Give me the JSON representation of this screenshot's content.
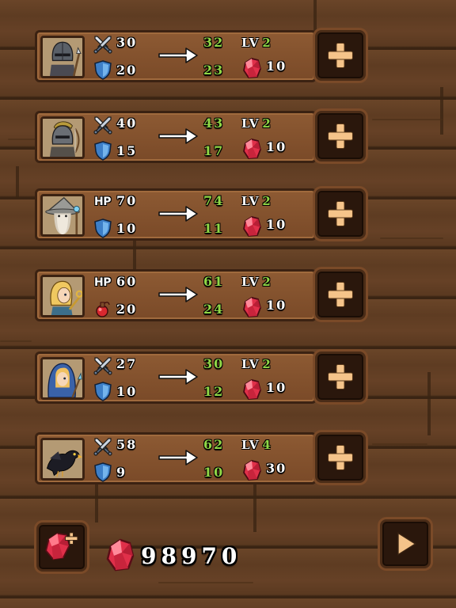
{
  "colors": {
    "wood_dark": "#3b2212",
    "panel": "#8d5a33",
    "new_value_green": "#8fd646",
    "gem_red": "#e0304a",
    "button_plus": "#f5c48a"
  },
  "heroes": [
    {
      "portrait_icon": "armored-knight-icon",
      "stat1_icon": "crossed-swords-icon",
      "stat1_label": "",
      "stat1_value": "30",
      "stat1_new": "32",
      "stat2_icon": "shield-icon",
      "stat2_value": "20",
      "stat2_new": "23",
      "level_label": "LV",
      "level": "2",
      "cost": "10"
    },
    {
      "portrait_icon": "spartan-archer-icon",
      "stat1_icon": "crossed-swords-icon",
      "stat1_label": "",
      "stat1_value": "40",
      "stat1_new": "43",
      "stat2_icon": "shield-icon",
      "stat2_value": "15",
      "stat2_new": "17",
      "level_label": "LV",
      "level": "2",
      "cost": "10"
    },
    {
      "portrait_icon": "grey-wizard-icon",
      "stat1_icon": "",
      "stat1_label": "HP",
      "stat1_value": "70",
      "stat1_new": "74",
      "stat2_icon": "shield-icon",
      "stat2_value": "10",
      "stat2_new": "11",
      "level_label": "LV",
      "level": "2",
      "cost": "10"
    },
    {
      "portrait_icon": "blonde-healer-icon",
      "stat1_icon": "",
      "stat1_label": "HP",
      "stat1_value": "60",
      "stat1_new": "61",
      "stat2_icon": "potion-icon",
      "stat2_value": "20",
      "stat2_new": "24",
      "level_label": "LV",
      "level": "2",
      "cost": "10"
    },
    {
      "portrait_icon": "blue-hooded-mage-icon",
      "stat1_icon": "crossed-swords-icon",
      "stat1_label": "",
      "stat1_value": "27",
      "stat1_new": "30",
      "stat2_icon": "shield-icon",
      "stat2_value": "10",
      "stat2_new": "12",
      "level_label": "LV",
      "level": "2",
      "cost": "10"
    },
    {
      "portrait_icon": "black-crow-icon",
      "stat1_icon": "crossed-swords-icon",
      "stat1_label": "",
      "stat1_value": "58",
      "stat1_new": "62",
      "stat2_icon": "shield-icon",
      "stat2_value": "9",
      "stat2_new": "10",
      "level_label": "LV",
      "level": "4",
      "cost": "30"
    }
  ],
  "footer": {
    "buy_gems_icon": "gem-plus-icon",
    "currency_icon": "gem-icon",
    "gem_total": "98970",
    "play_icon": "play-icon"
  }
}
